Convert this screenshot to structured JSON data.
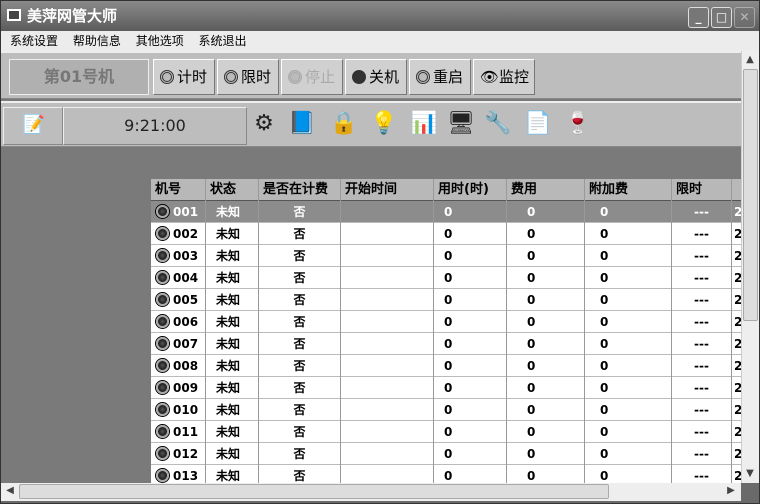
{
  "window": {
    "title": "美萍网管大师",
    "min": "_",
    "max": "□",
    "close": "✕"
  },
  "menu": [
    "系统设置",
    "帮助信息",
    "其他选项",
    "系统退出"
  ],
  "toolbar": {
    "machine_label": "第01号机",
    "buttons": [
      {
        "label": "计时",
        "enabled": true
      },
      {
        "label": "限时",
        "enabled": true
      },
      {
        "label": "停止",
        "enabled": false
      },
      {
        "label": "关机",
        "enabled": true
      },
      {
        "label": "重启",
        "enabled": true
      },
      {
        "label": "监控",
        "enabled": true,
        "icon": "eye-icon"
      }
    ]
  },
  "statusbar": {
    "time": "9:21:00",
    "icons": [
      "notepad-icon",
      "settings-icon",
      "help-book-icon",
      "lock-icon",
      "lightbulb-icon",
      "chart-icon",
      "network-icon",
      "tools-icon",
      "document-icon",
      "drinks-icon"
    ]
  },
  "table": {
    "columns": [
      "机号",
      "状态",
      "是否在计费",
      "开始时间",
      "用时(时)",
      "费用",
      "附加费",
      "限时",
      ""
    ],
    "rows": [
      [
        "001",
        "未知",
        "否",
        "",
        "0",
        "0",
        "0",
        "---",
        "2"
      ],
      [
        "002",
        "未知",
        "否",
        "",
        "0",
        "0",
        "0",
        "---",
        "2"
      ],
      [
        "003",
        "未知",
        "否",
        "",
        "0",
        "0",
        "0",
        "---",
        "2"
      ],
      [
        "004",
        "未知",
        "否",
        "",
        "0",
        "0",
        "0",
        "---",
        "2"
      ],
      [
        "005",
        "未知",
        "否",
        "",
        "0",
        "0",
        "0",
        "---",
        "2"
      ],
      [
        "006",
        "未知",
        "否",
        "",
        "0",
        "0",
        "0",
        "---",
        "2"
      ],
      [
        "007",
        "未知",
        "否",
        "",
        "0",
        "0",
        "0",
        "---",
        "2"
      ],
      [
        "008",
        "未知",
        "否",
        "",
        "0",
        "0",
        "0",
        "---",
        "2"
      ],
      [
        "009",
        "未知",
        "否",
        "",
        "0",
        "0",
        "0",
        "---",
        "2"
      ],
      [
        "010",
        "未知",
        "否",
        "",
        "0",
        "0",
        "0",
        "---",
        "2"
      ],
      [
        "011",
        "未知",
        "否",
        "",
        "0",
        "0",
        "0",
        "---",
        "2"
      ],
      [
        "012",
        "未知",
        "否",
        "",
        "0",
        "0",
        "0",
        "---",
        "2"
      ],
      [
        "013",
        "未知",
        "否",
        "",
        "0",
        "0",
        "0",
        "---",
        "2"
      ]
    ],
    "selected_row": 0
  }
}
